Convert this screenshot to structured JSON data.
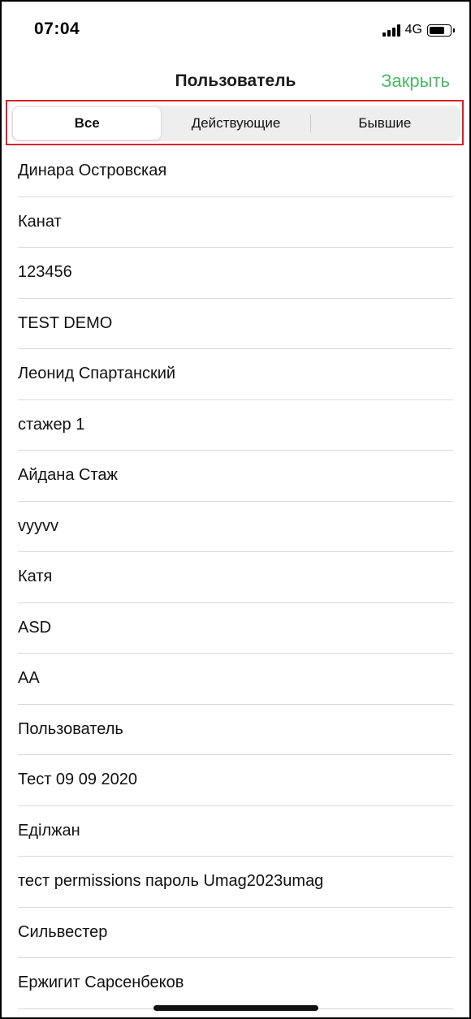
{
  "status_bar": {
    "time": "07:04",
    "network": "4G",
    "signal_icon": "cellular-signal-icon",
    "battery_icon": "battery-icon",
    "battery_level": 0.8
  },
  "nav": {
    "title": "Пользователь",
    "close_label": "Закрыть",
    "accent_color": "#4cb968"
  },
  "segments": {
    "items": [
      {
        "label": "Все",
        "selected": true
      },
      {
        "label": "Действующие",
        "selected": false
      },
      {
        "label": "Бывшие",
        "selected": false
      }
    ],
    "highlight_color": "#e01e2b"
  },
  "users": [
    "Динара Островская",
    "Канат",
    "123456",
    "TEST DEMO",
    "Леонид Спартанский",
    "стажер 1",
    "Айдана Стаж",
    "vyyvv",
    "Катя",
    "ASD",
    "AA",
    "Пользователь",
    "Тест 09 09 2020",
    "Еділжан",
    "тест permissions пароль Umag2023umag",
    "Сильвестер",
    "Ержигит Сарсенбеков"
  ]
}
